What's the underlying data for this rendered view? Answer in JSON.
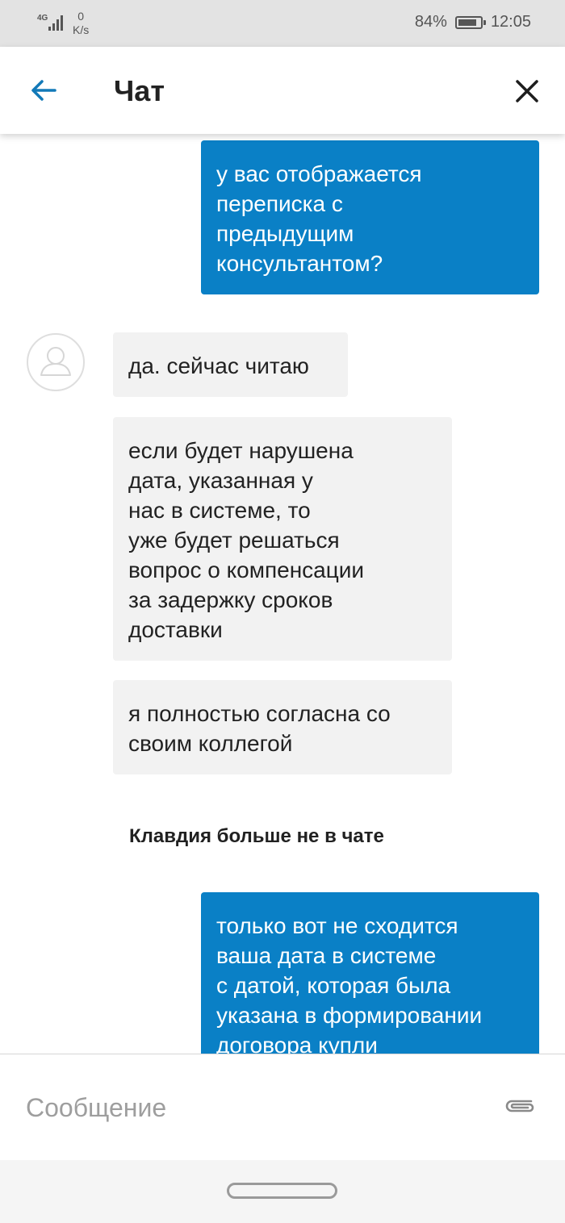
{
  "status_bar": {
    "network": "4G",
    "speed_value": "0",
    "speed_unit": "K/s",
    "battery_percent_text": "84%",
    "battery_level": 0.84,
    "time": "12:05"
  },
  "header": {
    "title": "Чат",
    "back_icon": "arrow-left-icon",
    "close_icon": "close-icon"
  },
  "messages": [
    {
      "direction": "out",
      "text": "у вас отображается\nпереписка с\nпредыдущим\nконсультантом?"
    },
    {
      "direction": "in",
      "text": "да. сейчас читаю"
    },
    {
      "direction": "in",
      "text": "если будет нарушена\nдата, указанная у\nнас в системе, то\nуже будет решаться\nвопрос о компенсации\nза задержку сроков\nдоставки"
    },
    {
      "direction": "in",
      "text": "я полностью согласна со\nсвоим коллегой"
    },
    {
      "direction": "out",
      "text": "только вот не сходится\nваша дата в системе\nс датой, которая была\nуказана в формировании\nдоговора купли"
    }
  ],
  "system_note": "Клавдия больше не в чате",
  "input": {
    "placeholder": "Сообщение",
    "value": "",
    "attach_icon": "paperclip-icon"
  },
  "colors": {
    "accent": "#0a80c6",
    "incoming_bubble": "#f2f2f2",
    "status_bar_bg": "#e3e3e3"
  }
}
